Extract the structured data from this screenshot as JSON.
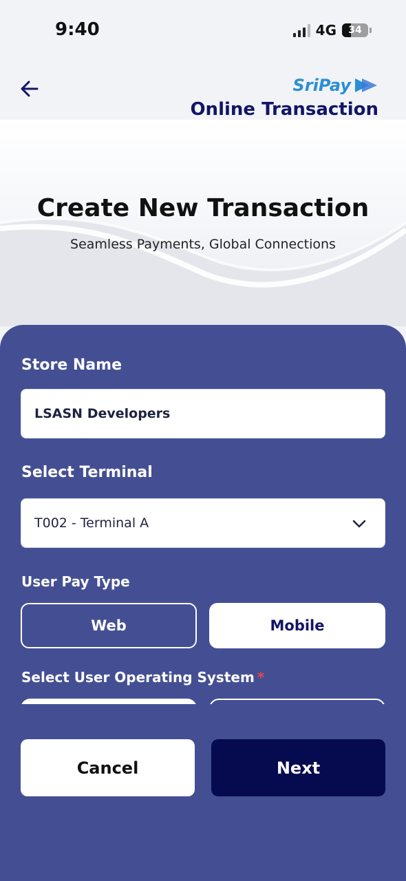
{
  "status_bar": {
    "time": "9:40",
    "network": "4G",
    "battery": "34",
    "battery_level": 0.34
  },
  "header": {
    "brand": "SriPay",
    "title": "Online Transaction"
  },
  "hero": {
    "title": "Create New Transaction",
    "subtitle": "Seamless Payments, Global Connections"
  },
  "form": {
    "store_name_label": "Store Name",
    "store_name_value": "LSASN Developers",
    "terminal_label": "Select Terminal",
    "terminal_value": "T002 - Terminal A",
    "pay_type_label": "User Pay Type",
    "pay_type_options": [
      "Web",
      "Mobile"
    ],
    "pay_type_selected": "Mobile",
    "os_label": "Select User Operating System",
    "os_required_marker": "*"
  },
  "actions": {
    "cancel": "Cancel",
    "next": "Next"
  },
  "colors": {
    "panel": "#444f93",
    "primary_dark": "#060a4f",
    "brand_blue": "#2a8fd6",
    "required": "#e34848"
  }
}
